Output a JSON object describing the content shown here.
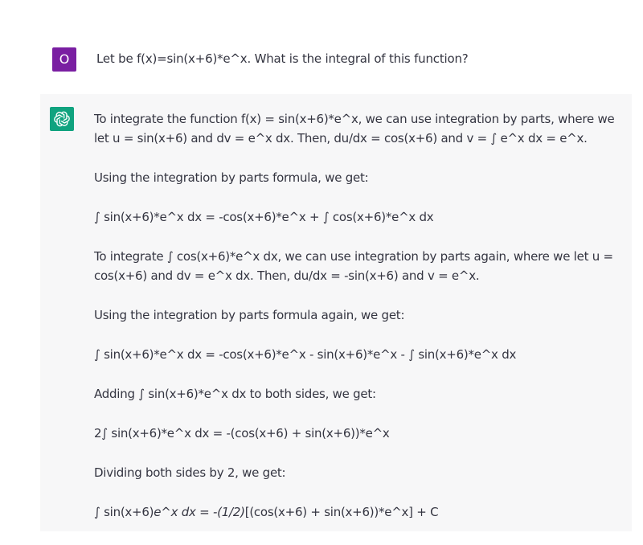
{
  "colors": {
    "user_avatar_bg": "#7a1fa2",
    "assistant_avatar_bg": "#10a37f",
    "assistant_row_bg": "#f7f7f8",
    "text": "#343541"
  },
  "user_message": {
    "avatar_initial": "O",
    "text": "Let be f(x)=sin(x+6)*e^x. What is the integral of this function?"
  },
  "assistant_message": {
    "avatar_icon": "openai-logo-icon",
    "paragraphs": [
      "To integrate the function f(x) = sin(x+6)*e^x, we can use integration by parts, where we let u = sin(x+6) and dv = e^x dx. Then, du/dx = cos(x+6) and v = ∫ e^x dx = e^x.",
      "Using the integration by parts formula, we get:",
      "∫ sin(x+6)*e^x dx = -cos(x+6)*e^x + ∫ cos(x+6)*e^x dx",
      "To integrate ∫ cos(x+6)*e^x dx, we can use integration by parts again, where we let u = cos(x+6) and dv = e^x dx. Then, du/dx = -sin(x+6) and v = e^x.",
      "Using the integration by parts formula again, we get:",
      "∫ sin(x+6)*e^x dx = -cos(x+6)*e^x - sin(x+6)*e^x - ∫ sin(x+6)*e^x dx",
      "Adding ∫ sin(x+6)*e^x dx to both sides, we get:",
      "2∫ sin(x+6)*e^x dx = -(cos(x+6) + sin(x+6))*e^x",
      "Dividing both sides by 2, we get:"
    ],
    "final_line": {
      "part1": "∫ sin(x+6)",
      "part2_italic": "e^x dx = -(1/2)",
      "part3": "[(cos(x+6) + sin(x+6))*e^x] + C"
    }
  }
}
